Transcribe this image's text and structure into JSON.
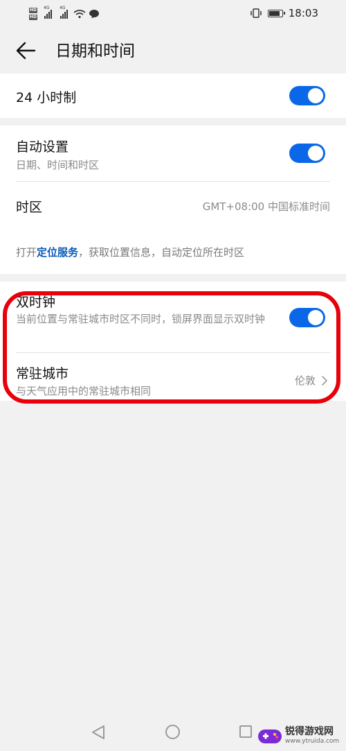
{
  "status_bar": {
    "hd_badge": "HD",
    "network_1": "4G",
    "network_2": "4G",
    "time": "18:03",
    "battery_level": 0.9
  },
  "header": {
    "title": "日期和时间"
  },
  "settings": {
    "hour24": {
      "label": "24 小时制",
      "enabled": true
    },
    "auto_set": {
      "label": "自动设置",
      "sublabel": "日期、时间和时区",
      "enabled": true
    },
    "timezone": {
      "label": "时区",
      "value": "GMT+08:00 中国标准时间"
    },
    "location_hint": {
      "prefix": "打开",
      "link": "定位服务",
      "suffix": "，获取位置信息，自动定位所在时区"
    },
    "dual_clock": {
      "label": "双时钟",
      "sublabel": "当前位置与常驻城市时区不同时，锁屏界面显示双时钟",
      "enabled": true
    },
    "home_city": {
      "label": "常驻城市",
      "sublabel": "与天气应用中的常驻城市相同",
      "value": "伦敦"
    }
  },
  "highlight_color": "#e8000b",
  "accent_color": "#0a68e8",
  "watermark": {
    "title": "锐得游戏网",
    "url": "www.ytruida.com"
  }
}
